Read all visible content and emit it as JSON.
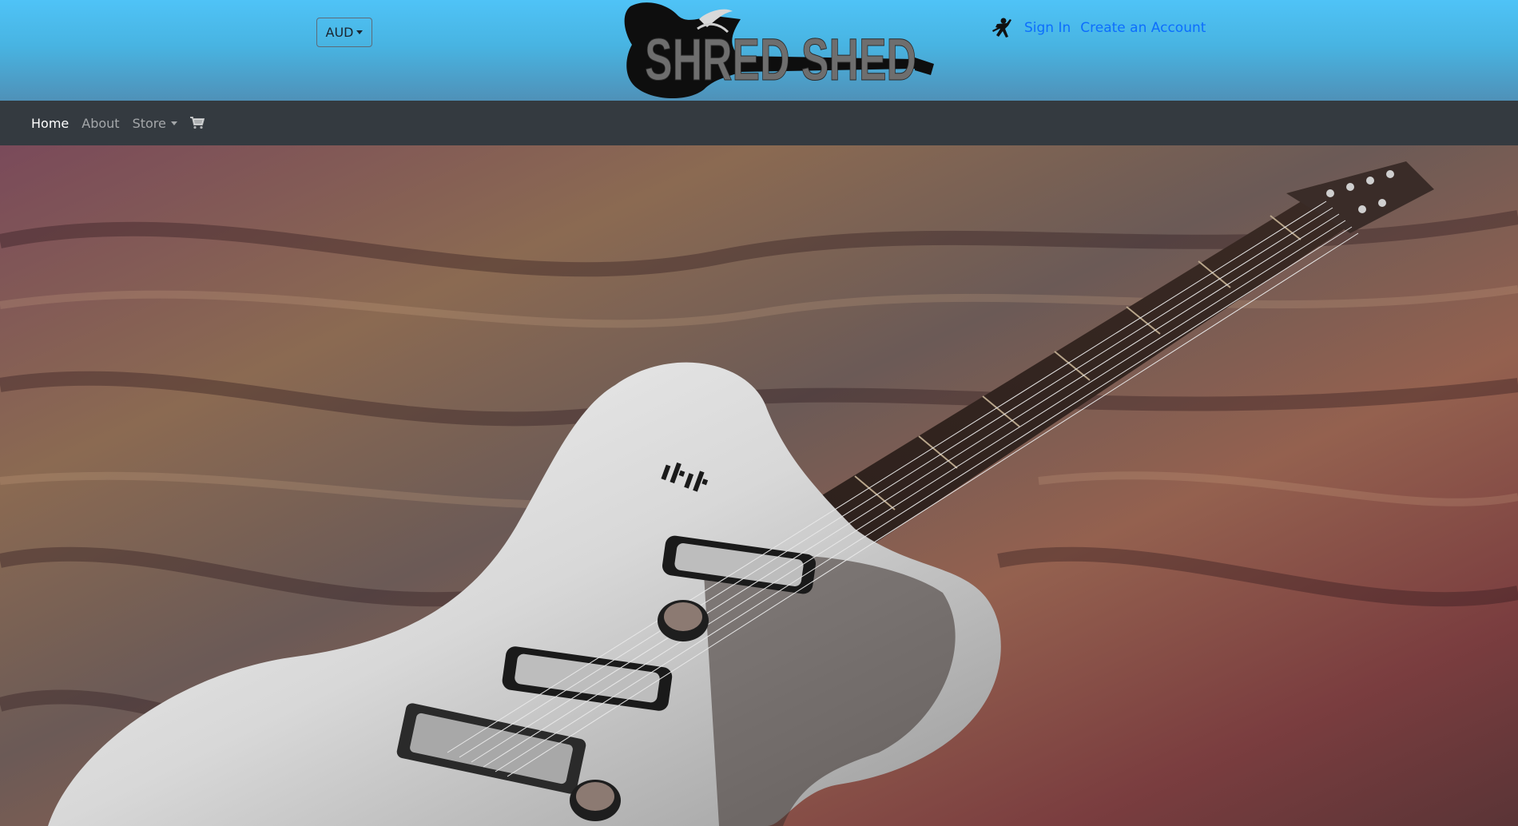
{
  "header": {
    "currency": "AUD",
    "logo_text": "SHRED SHED",
    "account_icon": "guitarist-silhouette-icon",
    "sign_in": "Sign In",
    "create_account": "Create an Account"
  },
  "nav": {
    "items": [
      {
        "label": "Home",
        "active": true
      },
      {
        "label": "About",
        "active": false
      },
      {
        "label": "Store",
        "active": false,
        "dropdown": true
      }
    ],
    "cart_icon": "cart-icon"
  },
  "hero": {
    "image": "electric-guitar-on-fabric"
  },
  "colors": {
    "header_top": "#4fc3f7",
    "navbar": "#343a40",
    "link": "#0d6efd"
  }
}
